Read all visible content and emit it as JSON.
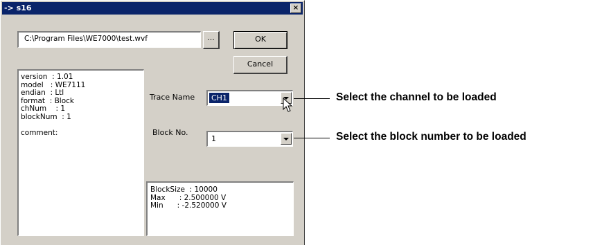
{
  "window": {
    "title": "-> s16",
    "close_label": "×"
  },
  "file": {
    "path": "C:\\Program Files\\WE7000\\test.wvf",
    "browse_label": "..."
  },
  "buttons": {
    "ok_label": "OK",
    "cancel_label": "Cancel"
  },
  "info_lines": [
    "version  : 1.01",
    "model   : WE7111",
    "endian  : Ltl",
    "format  : Block",
    "chNum    : 1",
    "blockNum  : 1",
    "",
    "comment:"
  ],
  "trace": {
    "label": "Trace Name",
    "value": "CH1"
  },
  "block": {
    "label": "Block No.",
    "value": "1"
  },
  "stats_lines": [
    "BlockSize  : 10000",
    "Max      : 2.500000 V",
    "Min      : -2.520000 V"
  ],
  "annotations": {
    "trace_callout": "Select the channel to be loaded",
    "block_callout": "Select the block number to be loaded"
  },
  "colors": {
    "titlebar": "#0a246a",
    "dialog_face": "#d4d0c8",
    "selection": "#0a246a"
  }
}
